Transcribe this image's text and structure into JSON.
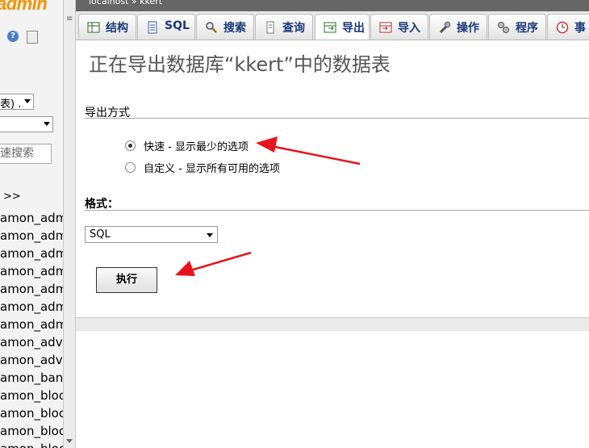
{
  "nav": {
    "logo_text": "admin",
    "select_db_value": "表) .",
    "search_placeholder": "速搜索",
    "pages": ">>",
    "tables": [
      "amon_admi",
      "amon_admi",
      "amon_admi",
      "amon_admi",
      "amon_admi",
      "amon_admi",
      "amon_admi",
      "amon_adve",
      "amon_adve",
      "amon_bann",
      "amon_block",
      "amon_block",
      "amon_block",
      "amon_block"
    ]
  },
  "breadcrumb": {
    "text": "localhost » kkert"
  },
  "tabs": [
    {
      "label": "结构",
      "icon": "structure-icon"
    },
    {
      "label": "SQL",
      "icon": "sql-icon"
    },
    {
      "label": "搜索",
      "icon": "search-icon"
    },
    {
      "label": "查询",
      "icon": "query-icon"
    },
    {
      "label": "导出",
      "icon": "export-icon",
      "active": true
    },
    {
      "label": "导入",
      "icon": "import-icon"
    },
    {
      "label": "操作",
      "icon": "wrench-icon"
    },
    {
      "label": "程序",
      "icon": "routines-icon"
    },
    {
      "label": "事",
      "icon": "events-icon"
    }
  ],
  "main": {
    "title": "正在导出数据库“kkert”中的数据表",
    "export_method_legend": "导出方式",
    "options": [
      {
        "label": "快速 - 显示最少的选项",
        "selected": true
      },
      {
        "label": "自定义 - 显示所有可用的选项",
        "selected": false
      }
    ],
    "format_legend": "格式：",
    "format_value": "SQL",
    "go_label": "执行"
  },
  "colors": {
    "logo": "#f39300",
    "arrow": "#e8141b",
    "tab_text": "#1a3a7a"
  }
}
